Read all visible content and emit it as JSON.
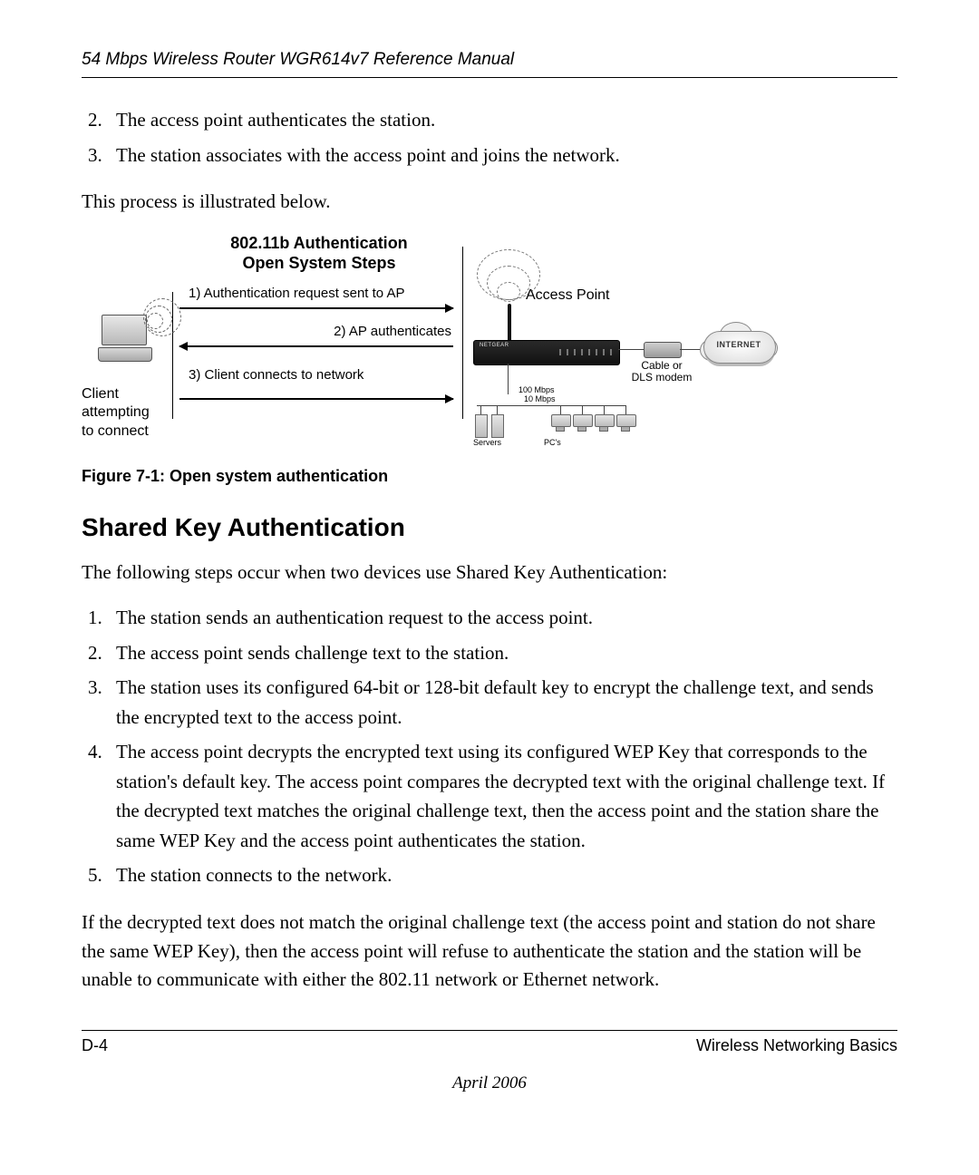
{
  "header": {
    "running_title": "54 Mbps Wireless Router WGR614v7 Reference Manual"
  },
  "intro_list_start": 2,
  "intro_list": [
    "The access point authenticates the station.",
    "The station associates with the access point and joins the network."
  ],
  "intro_para": "This process is illustrated below.",
  "figure": {
    "title_line1": "802.11b Authentication",
    "title_line2": "Open System Steps",
    "step1": "1) Authentication request sent to AP",
    "step2": "2) AP authenticates",
    "step3": "3) Client connects to network",
    "client_label_l1": "Client",
    "client_label_l2": "attempting",
    "client_label_l3": "to connect",
    "ap_label": "Access Point",
    "modem_label_l1": "Cable or",
    "modem_label_l2": "DLS modem",
    "internet_label": "INTERNET",
    "net_100": "100 Mbps",
    "net_10": "10 Mbps",
    "servers_label": "Servers",
    "pcs_label": "PC's"
  },
  "figure_caption": "Figure 7-1:  Open system authentication",
  "section_heading": "Shared Key Authentication",
  "section_intro": "The following steps occur when two devices use Shared Key Authentication:",
  "steps": [
    "The station sends an authentication request to the access point.",
    "The access point sends challenge text to the station.",
    "The station uses its configured 64-bit or 128-bit default key to encrypt the challenge text, and sends the encrypted text to the access point.",
    "The access point decrypts the encrypted text using its configured WEP Key that corresponds to the station's default key. The access point compares the decrypted text with the original challenge text. If the decrypted text matches the original challenge text, then the access point and the station share the same WEP Key and the access point authenticates the station.",
    "The station connects to the network."
  ],
  "closing_para": "If the decrypted text does not match the original challenge text (the access point and station do not share the same WEP Key), then the access point will refuse to authenticate the station and the station will be unable to communicate with either the 802.11 network or Ethernet network.",
  "footer": {
    "page_number": "D-4",
    "section_title": "Wireless Networking Basics",
    "date": "April 2006"
  }
}
